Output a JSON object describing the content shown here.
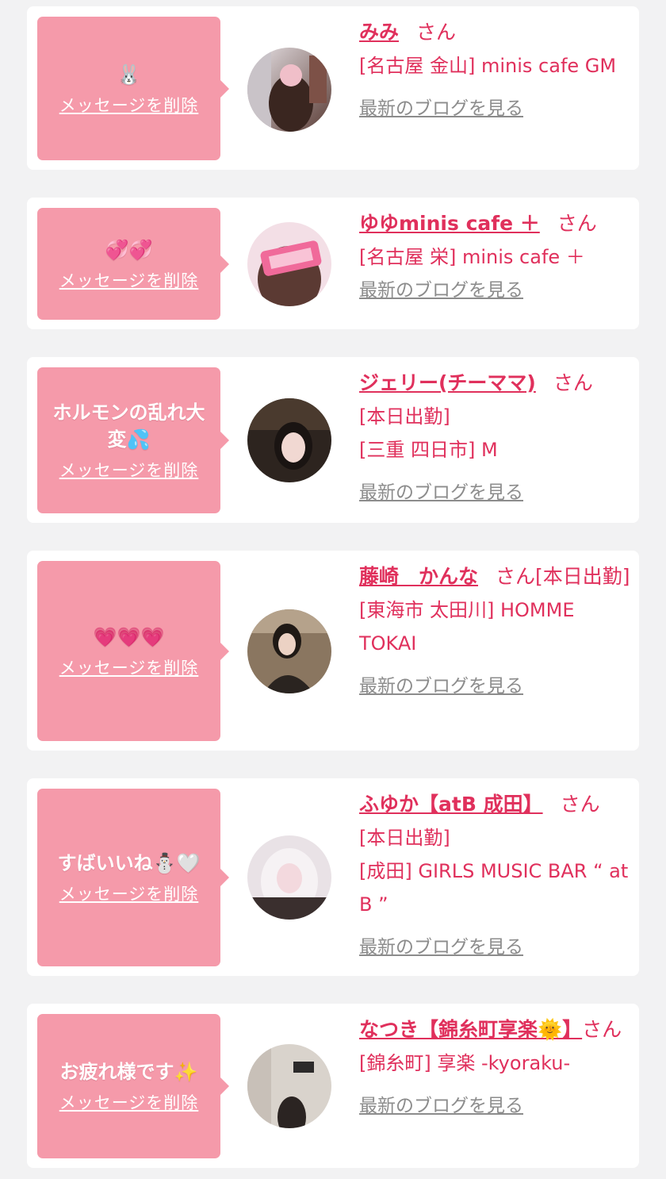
{
  "colors": {
    "accent": "#e0305c",
    "bubble": "#f59aaa",
    "card": "#ffffff",
    "bg": "#f2f2f3",
    "blog_link": "#8c8c8c"
  },
  "delete_label": "メッセージを削除",
  "blog_label": "最新のブログを見る",
  "san_label": "さん",
  "cards": [
    {
      "message": "🐰",
      "name": "みみ",
      "lines": [
        "[名古屋 金山] minis cafe GM"
      ]
    },
    {
      "message": "💞💞",
      "name": "ゆゆminis cafe ＋",
      "lines": [
        "[名古屋 栄] minis cafe ＋"
      ]
    },
    {
      "message": "ホルモンの乱れ大変💦",
      "name": "ジェリー(チーママ)",
      "lines": [
        "[本日出勤]",
        "[三重 四日市] M"
      ]
    },
    {
      "message": "💗💗💗",
      "name": "藤崎　かんな",
      "name_suffix": "[本日出勤]",
      "lines": [
        "[東海市 太田川] HOMME TOKAI"
      ]
    },
    {
      "message": "すばいいね⛄🤍",
      "name": "ふゆか【atB 成田】",
      "lines": [
        "[本日出勤]",
        "[成田] GIRLS MUSIC BAR “ at B ”"
      ]
    },
    {
      "message": "お疲れ様です✨",
      "name": "なつき【錦糸町享楽🌞】",
      "lines": [
        "[錦糸町] 享楽 -kyoraku-"
      ]
    }
  ]
}
